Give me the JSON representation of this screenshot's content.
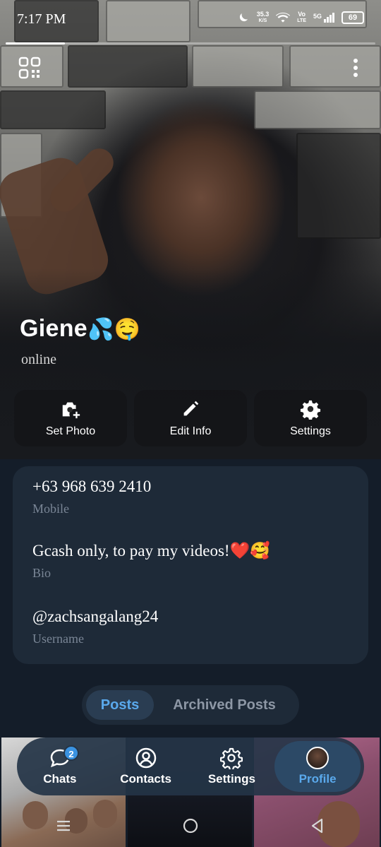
{
  "status_bar": {
    "time": "7:17 PM",
    "speed_value": "35.3",
    "speed_unit": "K/S",
    "volte_top": "Vo",
    "volte_bottom": "LTE",
    "network": "5G",
    "battery": "69"
  },
  "story_progress": 0.16,
  "profile": {
    "name": "Giene",
    "name_emoji": "💦🤤",
    "presence": "online"
  },
  "actions": [
    {
      "label": "Set Photo",
      "icon": "camera-add-icon"
    },
    {
      "label": "Edit Info",
      "icon": "pencil-icon"
    },
    {
      "label": "Settings",
      "icon": "gear-icon"
    }
  ],
  "info": {
    "phone": {
      "value": "+63 968 639 2410",
      "label": "Mobile"
    },
    "bio": {
      "value": "Gcash only, to pay my videos!❤️🥰",
      "label": "Bio"
    },
    "username": {
      "value": "@zachsangalang24",
      "label": "Username"
    }
  },
  "tabs": [
    {
      "label": "Posts",
      "active": true
    },
    {
      "label": "Archived Posts",
      "active": false
    }
  ],
  "bottom_nav": [
    {
      "label": "Chats",
      "icon": "chat-icon",
      "badge": "2"
    },
    {
      "label": "Contacts",
      "icon": "person-circle-icon"
    },
    {
      "label": "Settings",
      "icon": "gear-icon"
    },
    {
      "label": "Profile",
      "icon": "avatar",
      "active": true
    }
  ],
  "colors": {
    "background": "#141d29",
    "card": "#1e2a38",
    "accent": "#5aa9ec",
    "label": "#7a8696"
  }
}
